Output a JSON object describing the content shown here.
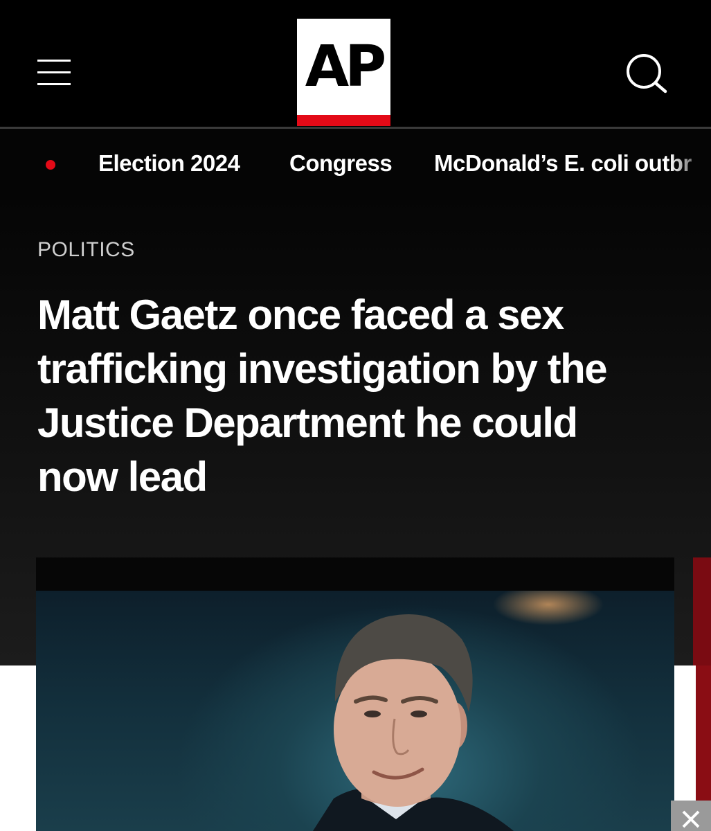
{
  "header": {
    "logo_text": "AP",
    "menu_icon": "hamburger-menu-icon",
    "search_icon": "search-icon",
    "brand_red": "#e30a17"
  },
  "nav": {
    "live_indicator": "red-dot-icon",
    "items": [
      {
        "label": "Election 2024"
      },
      {
        "label": "Congress"
      },
      {
        "label": "McDonald’s E. coli outbr"
      }
    ]
  },
  "article": {
    "kicker": "POLITICS",
    "headline": "Matt Gaetz once faced a sex trafficking investigation by the Justice Department he could now lead",
    "image": "photo-of-matt-gaetz"
  },
  "ad": {
    "close_icon": "close-icon"
  }
}
